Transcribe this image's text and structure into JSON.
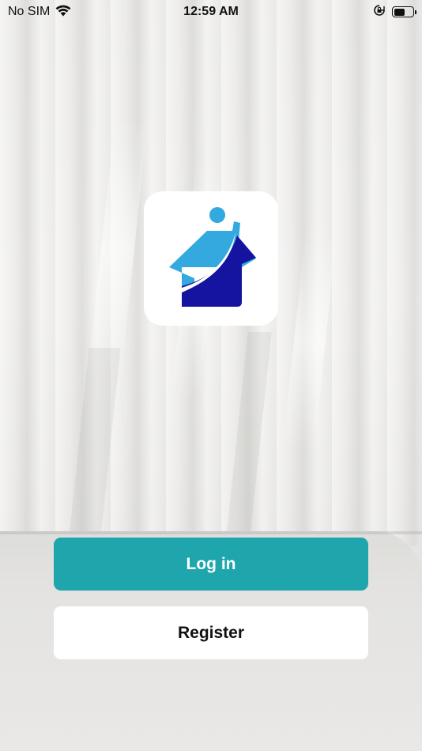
{
  "status_bar": {
    "carrier": "No SIM",
    "time": "12:59 AM",
    "battery_level": 0.62
  },
  "logo": {
    "icon": "house-logo-icon",
    "colors": {
      "light_blue": "#33a9e0",
      "dark_blue": "#1414a0",
      "tile": "#ffffff"
    }
  },
  "actions": {
    "login_label": "Log in",
    "register_label": "Register"
  },
  "theme": {
    "primary": "#1fa6ad",
    "secondary": "#ffffff"
  }
}
